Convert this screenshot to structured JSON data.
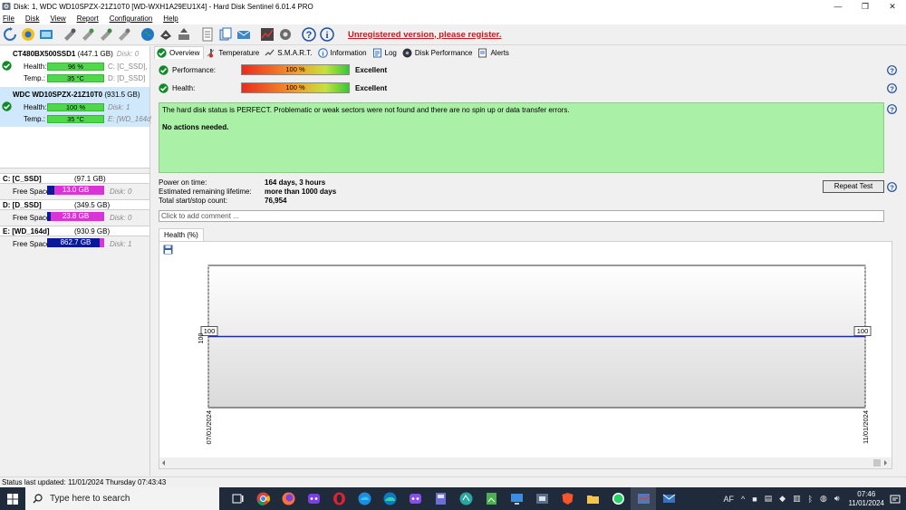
{
  "window": {
    "title": "Disk: 1, WDC WD10SPZX-21Z10T0 [WD-WXH1A29EU1X4] - Hard Disk Sentinel 6.01.4 PRO",
    "minimize": "—",
    "maximize": "❐",
    "close": "✕"
  },
  "menu": [
    "File",
    "Disk",
    "View",
    "Report",
    "Configuration",
    "Help"
  ],
  "toolbar": {
    "register_text": "Unregistered version, please register."
  },
  "disks": [
    {
      "name": "CT480BX500SSD1",
      "size": "(447.1 GB)",
      "disk_num": "Disk: 0",
      "health_label": "Health:",
      "health": "96 %",
      "health_fraction": 0.96,
      "temp_label": "Temp.:",
      "temp": "35 °C",
      "volumes1": "C: [C_SSD],",
      "volumes2": "D: [D_SSD]",
      "selected": false
    },
    {
      "name": "WDC WD10SPZX-21Z10T0",
      "size": "(931.5 GB)",
      "disk_num": "",
      "health_label": "Health:",
      "health": "100 %",
      "health_fraction": 1.0,
      "temp_label": "Temp.:",
      "temp": "35 °C",
      "volumes1": "Disk: 1",
      "volumes2": "E: [WD_164d]",
      "selected": true
    }
  ],
  "volumes": [
    {
      "name": "C: [C_SSD]",
      "size": "(97.1 GB)",
      "free_label": "Free Space",
      "free": "13.0 GB",
      "free_fraction": 0.134,
      "disk": "Disk: 0"
    },
    {
      "name": "D: [D_SSD]",
      "size": "(349.5 GB)",
      "free_label": "Free Space",
      "free": "23.8 GB",
      "free_fraction": 0.068,
      "disk": "Disk: 0"
    },
    {
      "name": "E: [WD_164d]",
      "size": "(930.9 GB)",
      "free_label": "Free Space",
      "free": "862.7 GB",
      "free_fraction": 0.927,
      "disk": "Disk: 1"
    }
  ],
  "tabs": [
    {
      "label": "Overview",
      "icon": "check-circle-icon",
      "active": true
    },
    {
      "label": "Temperature",
      "icon": "thermometer-icon",
      "active": false
    },
    {
      "label": "S.M.A.R.T.",
      "icon": "smart-icon",
      "active": false
    },
    {
      "label": "Information",
      "icon": "info-icon",
      "active": false
    },
    {
      "label": "Log",
      "icon": "log-icon",
      "active": false
    },
    {
      "label": "Disk Performance",
      "icon": "disk-performance-icon",
      "active": false
    },
    {
      "label": "Alerts",
      "icon": "alerts-icon",
      "active": false
    }
  ],
  "overview": {
    "performance_label": "Performance:",
    "performance_value": "100 %",
    "performance_verdict": "Excellent",
    "health_label": "Health:",
    "health_value": "100 %",
    "health_verdict": "Excellent",
    "status_line1": "The hard disk status is PERFECT. Problematic or weak sectors were not found and there are no spin up or data transfer errors.",
    "status_line2": "No actions needed.",
    "power_on_label": "Power on time:",
    "power_on_value": "164 days, 3 hours",
    "lifetime_label": "Estimated remaining lifetime:",
    "lifetime_value": "more than 1000 days",
    "startstop_label": "Total start/stop count:",
    "startstop_value": "76,954",
    "repeat_button": "Repeat Test",
    "comment_placeholder": "Click to add comment ...",
    "subtab_label": "Health (%)"
  },
  "chart_data": {
    "type": "line",
    "title": "",
    "xlabel": "",
    "ylabel": "",
    "x": [
      "07/01/2024",
      "11/01/2024"
    ],
    "series": [
      {
        "values": [
          100,
          100
        ]
      }
    ],
    "point_labels": [
      "100",
      "100"
    ],
    "y_tick_label": "100",
    "ylim": [
      50,
      150
    ],
    "grid": false,
    "line_color": "#1f2fa6"
  },
  "statusbar": {
    "text": "Status last updated: 11/01/2024 Thursday 07:43:43"
  },
  "taskbar": {
    "search_placeholder": "Type here to search",
    "lang": "AF",
    "time": "07:46",
    "date": "11/01/2024"
  },
  "colors": {
    "health_bar": "#4fd84a",
    "status_box": "#aaf0a6",
    "free_bar": "#0a1a9a",
    "used_bar": "#d934d6",
    "register": "#d0141e"
  }
}
